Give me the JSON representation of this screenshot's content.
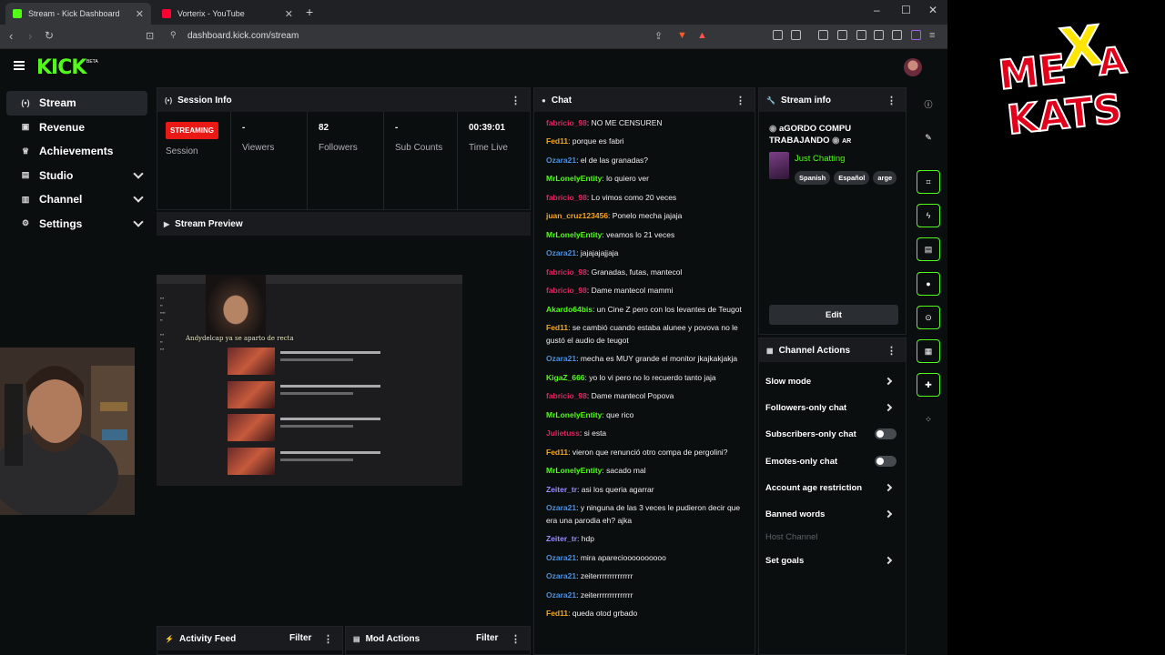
{
  "browser": {
    "tabs": [
      {
        "title": "Stream - Kick Dashboard",
        "favicon_color": "#53fc18",
        "active": true
      },
      {
        "title": "Vorterix - YouTube",
        "favicon_color": "#ff0033",
        "active": false
      }
    ],
    "url": "dashboard.kick.com/stream"
  },
  "nav": {
    "logo": "KICK",
    "beta": "BETA",
    "items": [
      {
        "label": "Stream",
        "icon": "broadcast-icon",
        "glyph": "(•)",
        "active": true,
        "expandable": false
      },
      {
        "label": "Revenue",
        "icon": "revenue-icon",
        "glyph": "▣",
        "active": false,
        "expandable": false
      },
      {
        "label": "Achievements",
        "icon": "trophy-icon",
        "glyph": "🏆",
        "active": false,
        "expandable": false
      },
      {
        "label": "Studio",
        "icon": "studio-icon",
        "glyph": "▤",
        "active": false,
        "expandable": true
      },
      {
        "label": "Channel",
        "icon": "channel-icon",
        "glyph": "▥",
        "active": false,
        "expandable": true
      },
      {
        "label": "Settings",
        "icon": "gear-icon",
        "glyph": "⚙",
        "active": false,
        "expandable": true
      }
    ]
  },
  "session": {
    "title": "Session Info",
    "status": "STREAMING",
    "stats": [
      {
        "value": "",
        "label": "Session"
      },
      {
        "value": "-",
        "label": "Viewers"
      },
      {
        "value": "82",
        "label": "Followers"
      },
      {
        "value": "-",
        "label": "Sub Counts"
      },
      {
        "value": "00:39:01",
        "label": "Time Live"
      }
    ]
  },
  "preview": {
    "title": "Stream Preview",
    "overlay_text": "Andydelcap ya se aparto de recta"
  },
  "activity": {
    "title": "Activity Feed",
    "filter": "Filter"
  },
  "mod": {
    "title": "Mod Actions",
    "filter": "Filter"
  },
  "chat": {
    "title": "Chat",
    "messages": [
      {
        "user": "fabricio_98",
        "color": "#e0245e",
        "text": "NO ME CENSUREN"
      },
      {
        "user": "Fed11",
        "color": "#f5a623",
        "text": "porque es fabri"
      },
      {
        "user": "Ozara21",
        "color": "#4a90e2",
        "text": "el de las granadas?"
      },
      {
        "user": "MrLonelyEntity",
        "color": "#53fc18",
        "text": "lo quiero ver"
      },
      {
        "user": "fabricio_98",
        "color": "#e0245e",
        "text": "Lo vimos como 20 veces"
      },
      {
        "user": "juan_cruz123456",
        "color": "#f5a623",
        "text": "Ponelo mecha jajaja"
      },
      {
        "user": "MrLonelyEntity",
        "color": "#53fc18",
        "text": "veamos lo 21 veces"
      },
      {
        "user": "Ozara21",
        "color": "#4a90e2",
        "text": "jajajajajjaja"
      },
      {
        "user": "fabricio_98",
        "color": "#e0245e",
        "text": "Granadas, futas, mantecol"
      },
      {
        "user": "fabricio_98",
        "color": "#e0245e",
        "text": "Dame mantecol mammi"
      },
      {
        "user": "Akardo64bis",
        "color": "#53fc18",
        "text": "un Cine Z pero con los levantes de Teugot"
      },
      {
        "user": "Fed11",
        "color": "#f5a623",
        "text": "se cambió cuando estaba alunee y povova no le gustó el audio de teugot"
      },
      {
        "user": "Ozara21",
        "color": "#4a90e2",
        "text": "mecha es MUY grande el monitor jkajkakjakja"
      },
      {
        "user": "KigaZ_666",
        "color": "#53fc18",
        "text": "yo lo vi pero no lo recuerdo tanto jaja"
      },
      {
        "user": "fabricio_98",
        "color": "#e0245e",
        "text": "Dame mantecol Popova"
      },
      {
        "user": "MrLonelyEntity",
        "color": "#53fc18",
        "text": "que rico"
      },
      {
        "user": "Julietuss",
        "color": "#e0245e",
        "text": "si esta"
      },
      {
        "user": "Fed11",
        "color": "#f5a623",
        "text": "vieron que renunció otro compa de pergolini?"
      },
      {
        "user": "MrLonelyEntity",
        "color": "#53fc18",
        "text": "sacado mal"
      },
      {
        "user": "Zeiter_tr",
        "color": "#9b8cff",
        "text": "asi los queria agarrar"
      },
      {
        "user": "Ozara21",
        "color": "#4a90e2",
        "text": "y ninguna de las 3 veces le pudieron decir que era una parodia eh? ajka"
      },
      {
        "user": "Zeiter_tr",
        "color": "#9b8cff",
        "text": "hdp"
      },
      {
        "user": "Ozara21",
        "color": "#4a90e2",
        "text": "mira aparecioooooooooo"
      },
      {
        "user": "Ozara21",
        "color": "#4a90e2",
        "text": "zeiterrrrrrrrrrrrrr"
      },
      {
        "user": "Ozara21",
        "color": "#4a90e2",
        "text": "zeiterrrrrrrrrrrrrr"
      },
      {
        "user": "Fed11",
        "color": "#f5a623",
        "text": "queda otod grbado"
      }
    ]
  },
  "stream_info": {
    "title": "Stream info",
    "stream_title_line1": "aGORDO COMPU",
    "stream_title_line2": "TRABAJANDO",
    "stream_title_flag": "AR",
    "category": "Just Chatting",
    "tags": [
      "Spanish",
      "Español",
      "arge"
    ],
    "edit_label": "Edit"
  },
  "channel_actions": {
    "title": "Channel Actions",
    "items": [
      {
        "label": "Slow mode",
        "kind": "chevron"
      },
      {
        "label": "Followers-only chat",
        "kind": "chevron"
      },
      {
        "label": "Subscribers-only chat",
        "kind": "toggle"
      },
      {
        "label": "Emotes-only chat",
        "kind": "toggle"
      },
      {
        "label": "Account age restriction",
        "kind": "chevron"
      },
      {
        "label": "Banned words",
        "kind": "chevron"
      },
      {
        "label": "Host Channel",
        "kind": "disabled"
      },
      {
        "label": "Set goals",
        "kind": "chevron"
      }
    ]
  },
  "right_tools": [
    {
      "name": "info-icon",
      "glyph": "i",
      "outlined": false
    },
    {
      "name": "pencil-icon",
      "glyph": "✎",
      "outlined": false
    },
    {
      "name": "scan-icon",
      "glyph": "⌗",
      "outlined": true
    },
    {
      "name": "bolt-icon",
      "glyph": "⚡",
      "outlined": true
    },
    {
      "name": "doc-icon",
      "glyph": "▤",
      "outlined": true
    },
    {
      "name": "chat-bubble-icon",
      "glyph": "●",
      "outlined": true
    },
    {
      "name": "broadcast-icon",
      "glyph": "(•)",
      "outlined": true
    },
    {
      "name": "layout-icon",
      "glyph": "▦",
      "outlined": true
    },
    {
      "name": "wrench-icon",
      "glyph": "🔧",
      "outlined": true
    },
    {
      "name": "nodes-icon",
      "glyph": "⁘",
      "outlined": false
    }
  ],
  "brand_logo": {
    "text_top": "MEXA",
    "text_bottom": "KATS",
    "red": "#e3001b",
    "yellow": "#ffe600"
  },
  "colors": {
    "accent": "#53fc18",
    "live": "#e91916",
    "panel": "#191b1f"
  }
}
